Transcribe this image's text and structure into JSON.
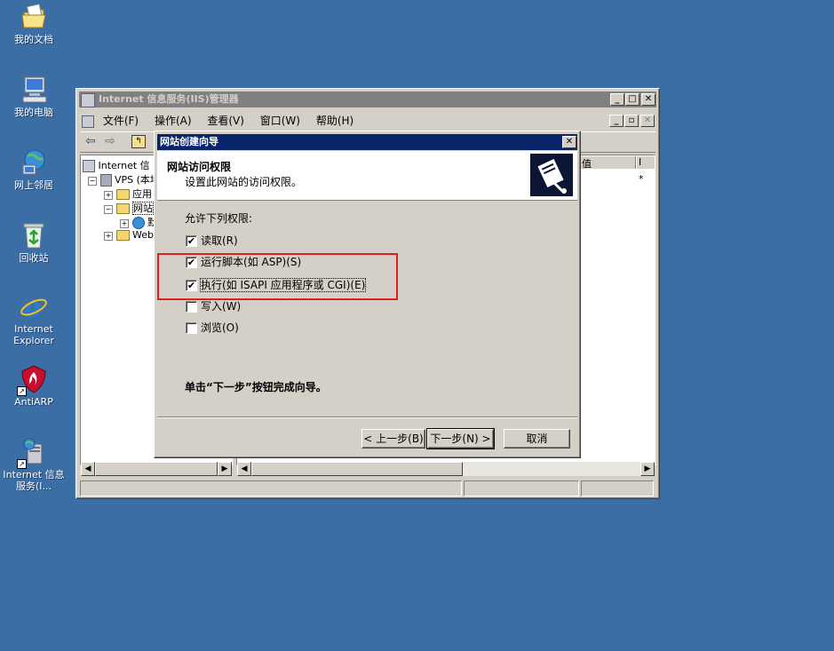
{
  "desktop": {
    "icons": [
      {
        "label": "我的文档",
        "icon": "folder-documents-icon"
      },
      {
        "label": "我的电脑",
        "icon": "my-computer-icon"
      },
      {
        "label": "网上邻居",
        "icon": "network-icon"
      },
      {
        "label": "回收站",
        "icon": "recycle-bin-icon"
      },
      {
        "label": "Internet Explorer",
        "icon": "internet-explorer-icon"
      },
      {
        "label": "AntiARP",
        "icon": "antiarp-shield-icon"
      },
      {
        "label": "Internet 信息服务(I...",
        "icon": "iis-manager-icon"
      }
    ]
  },
  "iis": {
    "title": "Internet 信息服务(IIS)管理器",
    "menu": [
      "文件(F)",
      "操作(A)",
      "查看(V)",
      "窗口(W)",
      "帮助(H)"
    ],
    "tree": {
      "root": "Internet 信",
      "server": "VPS (本地",
      "app_pools": "应用",
      "websites": "网站",
      "site": "默",
      "web_ext": "Web"
    },
    "column_partial": "值",
    "column_i": "I",
    "star": "*"
  },
  "wizard": {
    "title": "网站创建向导",
    "header_title": "网站访问权限",
    "header_subtitle": "设置此网站的访问权限。",
    "allow_label": "允许下列权限:",
    "permissions": [
      {
        "label": "读取(R)",
        "checked": true
      },
      {
        "label": "运行脚本(如 ASP)(S)",
        "checked": true
      },
      {
        "label": "执行(如 ISAPI 应用程序或 CGI)(E)",
        "checked": true
      },
      {
        "label": "写入(W)",
        "checked": false
      },
      {
        "label": "浏览(O)",
        "checked": false
      }
    ],
    "finish_text": "单击“下一步”按钮完成向导。",
    "buttons": {
      "back": "< 上一步(B)",
      "next": "下一步(N) >",
      "cancel": "取消"
    }
  },
  "colors": {
    "desktop": "#3a6ea5",
    "highlight_box": "#e0201a",
    "active_title": "#0a246a"
  }
}
